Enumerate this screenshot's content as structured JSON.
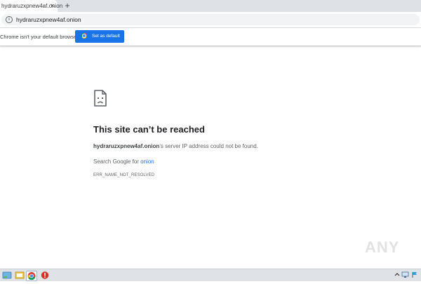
{
  "tab": {
    "title": "hydraruzxpnew4af.onion",
    "close_glyph": "✕",
    "new_tab_glyph": "+"
  },
  "address_bar": {
    "url": "hydraruzxpnew4af.onion",
    "info_glyph": "i"
  },
  "infobar": {
    "message": "Chrome isn't your default browser",
    "button_label": "Set as default"
  },
  "error": {
    "title": "This site can’t be reached",
    "host": "hydraruzxpnew4af.onion",
    "detail_suffix": "’s server IP address could not be found.",
    "search_prefix": "Search Google for ",
    "search_term": "onion",
    "code": "ERR_NAME_NOT_RESOLVED"
  },
  "watermark": {
    "text": "ANY"
  },
  "colors": {
    "accent": "#1a73e8",
    "tabstrip": "#dee1e6",
    "taskbar": "#dfe3e8"
  },
  "taskbar": {
    "items": [
      "start-icon",
      "explorer-icon",
      "chrome-icon",
      "alert-icon"
    ],
    "tray": [
      "tray-arrow-icon",
      "network-icon"
    ]
  }
}
